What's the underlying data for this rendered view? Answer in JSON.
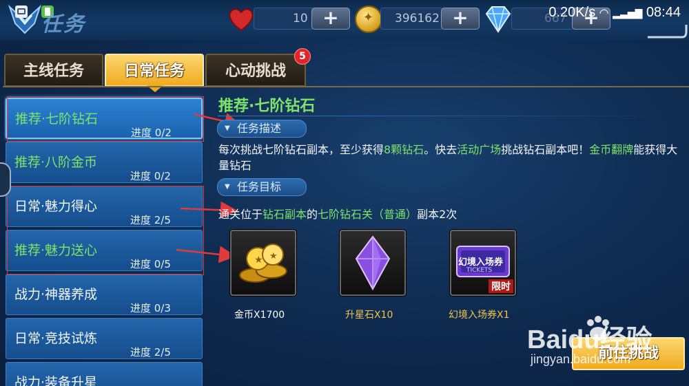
{
  "header": {
    "title": "任务",
    "hearts": "10",
    "gold": "396162",
    "diamonds_partial": "667",
    "network_speed": "0.20K/s",
    "time": "08:44"
  },
  "tabs": [
    {
      "label": "主线任务",
      "active": false
    },
    {
      "label": "日常任务",
      "active": true
    },
    {
      "label": "心动挑战",
      "active": false,
      "badge": "5"
    }
  ],
  "task_list": [
    {
      "name": "推荐·七阶钻石",
      "progress": "进度 0/2",
      "color": "green",
      "selected": true
    },
    {
      "name": "推荐·八阶金币",
      "progress": "进度 0/2",
      "color": "green",
      "selected": false
    },
    {
      "name": "日常·魅力得心",
      "progress": "进度 2/5",
      "color": "white",
      "selected": false
    },
    {
      "name": "推荐·魅力送心",
      "progress": "进度 0/5",
      "color": "green",
      "selected": false
    },
    {
      "name": "战力·神器养成",
      "progress": "进度 0/3",
      "color": "white",
      "selected": false
    },
    {
      "name": "日常·竞技试炼",
      "progress": "进度 2/5",
      "color": "white",
      "selected": false
    },
    {
      "name": "战力·装备升星",
      "progress": "",
      "color": "white",
      "selected": false
    }
  ],
  "detail": {
    "title": "推荐·七阶钻石",
    "section_desc_label": "任务描述",
    "desc": {
      "t1": "每次挑战七阶钻石副本，至少获得",
      "h1": "8颗钻石",
      "t2": "。快去",
      "h2": "活动广场",
      "t3": "挑战钻石副本吧！",
      "h3": "金币翻牌",
      "t4": "能获得大量钻石"
    },
    "section_goal_label": "任务目标",
    "goal": {
      "t1": "通关位于",
      "h1": "钻石副本",
      "t2": "的",
      "h2": "七阶钻石关（普通）",
      "t3": "副本2次"
    },
    "rewards": [
      {
        "icon": "gold-coins-icon",
        "label": "金币X1700",
        "color": "#ffffff"
      },
      {
        "icon": "star-stone-icon",
        "label": "升星石X10",
        "color": "#f2c44a"
      },
      {
        "icon": "ticket-icon",
        "label": "幻境入场券X1",
        "color": "#f2c44a",
        "tag": "限时",
        "ticket_text": "幻境入场券",
        "ticket_sub": "TICKETS"
      }
    ],
    "go_button": "前往挑战"
  },
  "watermark": {
    "brand": "Baidu经验",
    "url": "jingyan.baidu.com"
  },
  "colors": {
    "highlight_green": "#7de36b",
    "gold": "#f2c44a",
    "annotation_red": "#e23a3a"
  }
}
